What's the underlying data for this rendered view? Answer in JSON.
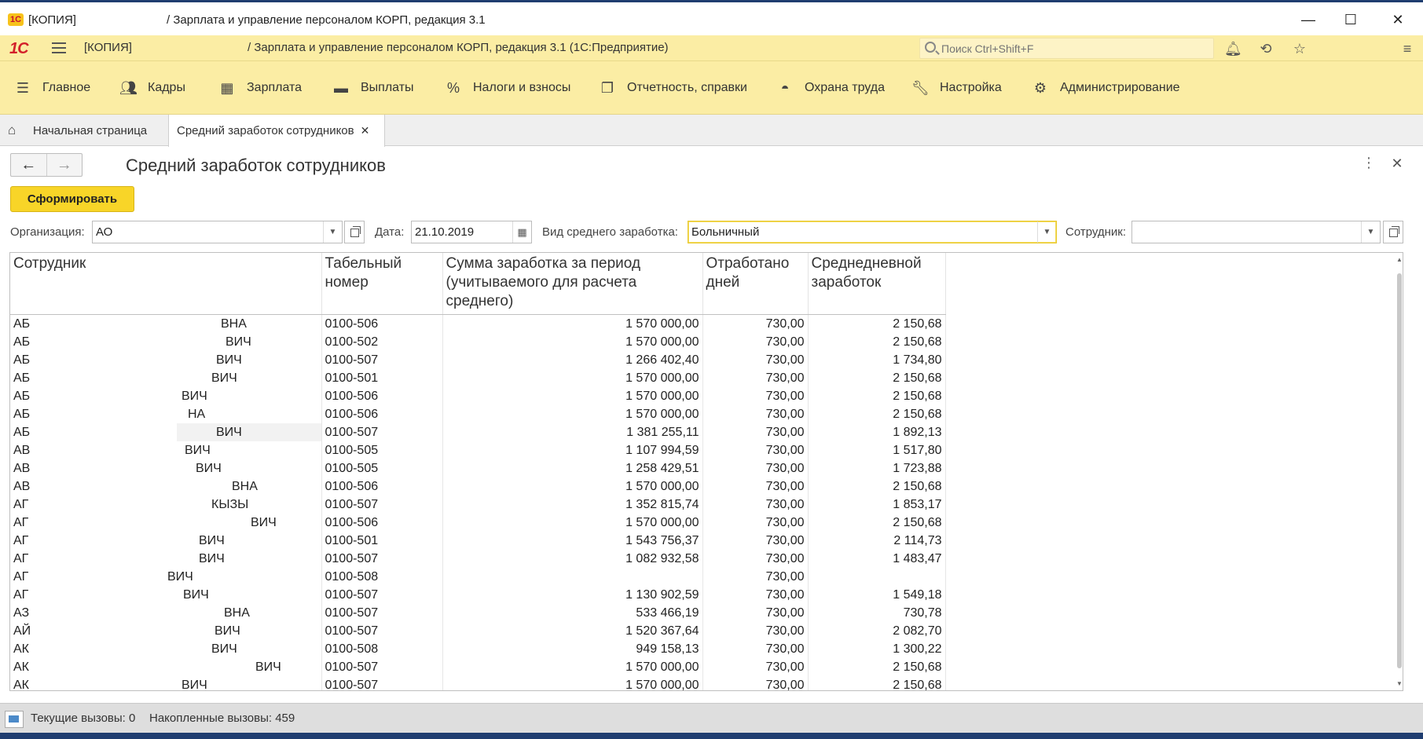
{
  "window": {
    "title_prefix": "[КОПИЯ]",
    "title": "/ Зарплата и управление персоналом КОРП, редакция 3.1"
  },
  "appbar": {
    "logo": "1С",
    "copy_label": "[КОПИЯ]",
    "title": "/ Зарплата и управление персоналом КОРП, редакция 3.1  (1С:Предприятие)",
    "search_placeholder": "Поиск Ctrl+Shift+F"
  },
  "sections": [
    {
      "label": "Главное",
      "icon": "menu-icon"
    },
    {
      "label": "Кадры",
      "icon": "people-icon"
    },
    {
      "label": "Зарплата",
      "icon": "calculator-icon"
    },
    {
      "label": "Выплаты",
      "icon": "wallet-icon"
    },
    {
      "label": "Налоги и взносы",
      "icon": "percent-icon"
    },
    {
      "label": "Отчетность, справки",
      "icon": "documents-icon"
    },
    {
      "label": "Охрана труда",
      "icon": "helmet-icon"
    },
    {
      "label": "Настройка",
      "icon": "wrench-icon"
    },
    {
      "label": "Администрирование",
      "icon": "gear-icon"
    }
  ],
  "tabs": {
    "home": "Начальная страница",
    "active": "Средний заработок сотрудников"
  },
  "form": {
    "title": "Средний заработок сотрудников",
    "generate_button": "Сформировать",
    "org_label": "Организация:",
    "org_value": "АО",
    "date_label": "Дата:",
    "date_value": "21.10.2019",
    "kind_label": "Вид среднего заработка:",
    "kind_value": "Больничный",
    "employee_label": "Сотрудник:",
    "employee_value": ""
  },
  "table": {
    "headers": [
      "Сотрудник",
      "Табельный номер",
      "Сумма заработка за период (учитываемого для расчета среднего)",
      "Отработано дней",
      "Среднедневной заработок"
    ],
    "rows": [
      {
        "last": "АБ",
        "patr": "ВНА",
        "num": "0100-506",
        "sum": "1 570 000,00",
        "days": "730,00",
        "avg": "2 150,68"
      },
      {
        "last": "АБ",
        "patr": "ВИЧ",
        "num": "0100-502",
        "sum": "1 570 000,00",
        "days": "730,00",
        "avg": "2 150,68"
      },
      {
        "last": "АБ",
        "patr": "ВИЧ",
        "num": "0100-507",
        "sum": "1 266 402,40",
        "days": "730,00",
        "avg": "1 734,80"
      },
      {
        "last": "АБ",
        "patr": "ВИЧ",
        "num": "0100-501",
        "sum": "1 570 000,00",
        "days": "730,00",
        "avg": "2 150,68"
      },
      {
        "last": "АБ",
        "patr": "ВИЧ",
        "num": "0100-506",
        "sum": "1 570 000,00",
        "days": "730,00",
        "avg": "2 150,68"
      },
      {
        "last": "АБ",
        "patr": "НА",
        "num": "0100-506",
        "sum": "1 570 000,00",
        "days": "730,00",
        "avg": "2 150,68"
      },
      {
        "last": "АБ",
        "patr": "ВИЧ",
        "num": "0100-507",
        "sum": "1 381 255,11",
        "days": "730,00",
        "avg": "1 892,13"
      },
      {
        "last": "АВ",
        "patr": "ВИЧ",
        "num": "0100-505",
        "sum": "1 107 994,59",
        "days": "730,00",
        "avg": "1 517,80"
      },
      {
        "last": "АВ",
        "patr": "ВИЧ",
        "num": "0100-505",
        "sum": "1 258 429,51",
        "days": "730,00",
        "avg": "1 723,88"
      },
      {
        "last": "АВ",
        "patr": "ВНА",
        "num": "0100-506",
        "sum": "1 570 000,00",
        "days": "730,00",
        "avg": "2 150,68"
      },
      {
        "last": "АГ",
        "patr": "КЫЗЫ",
        "num": "0100-507",
        "sum": "1 352 815,74",
        "days": "730,00",
        "avg": "1 853,17"
      },
      {
        "last": "АГ",
        "patr": "ВИЧ",
        "num": "0100-506",
        "sum": "1 570 000,00",
        "days": "730,00",
        "avg": "2 150,68"
      },
      {
        "last": "АГ",
        "patr": "ВИЧ",
        "num": "0100-501",
        "sum": "1 543 756,37",
        "days": "730,00",
        "avg": "2 114,73"
      },
      {
        "last": "АГ",
        "patr": "ВИЧ",
        "num": "0100-507",
        "sum": "1 082 932,58",
        "days": "730,00",
        "avg": "1 483,47"
      },
      {
        "last": "АГ",
        "patr": "ВИЧ",
        "num": "0100-508",
        "sum": "",
        "days": "730,00",
        "avg": ""
      },
      {
        "last": "АГ",
        "patr": "ВИЧ",
        "num": "0100-507",
        "sum": "1 130 902,59",
        "days": "730,00",
        "avg": "1 549,18"
      },
      {
        "last": "АЗ",
        "patr": "ВНА",
        "num": "0100-507",
        "sum": "533 466,19",
        "days": "730,00",
        "avg": "730,78"
      },
      {
        "last": "АЙ",
        "patr": "ВИЧ",
        "num": "0100-507",
        "sum": "1 520 367,64",
        "days": "730,00",
        "avg": "2 082,70"
      },
      {
        "last": "АК",
        "patr": "ВИЧ",
        "num": "0100-508",
        "sum": "949 158,13",
        "days": "730,00",
        "avg": "1 300,22"
      },
      {
        "last": "АК",
        "patr": "ВИЧ",
        "num": "0100-507",
        "sum": "1 570 000,00",
        "days": "730,00",
        "avg": "2 150,68"
      },
      {
        "last": "АК",
        "patr": "ВИЧ",
        "num": "0100-507",
        "sum": "1 570 000,00",
        "days": "730,00",
        "avg": "2 150,68"
      }
    ]
  },
  "status": {
    "current_calls": "Текущие вызовы: 0",
    "accumulated_calls": "Накопленные вызовы: 459"
  },
  "colors": {
    "accent_yellow": "#fbeda4",
    "button_yellow": "#f8d528",
    "window_frame": "#1f3d70",
    "logo_red": "#d3202a"
  }
}
